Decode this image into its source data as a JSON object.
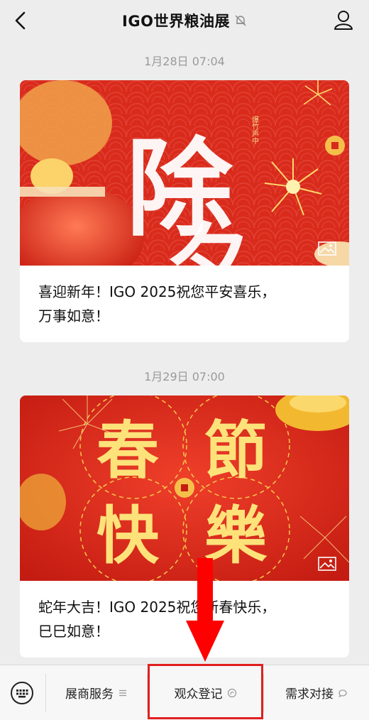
{
  "header": {
    "title": "IGO世界粮油展"
  },
  "messages": [
    {
      "date": "1月28日 07:04",
      "banner_text": "除夕",
      "caption_line1": "喜迎新年！IGO 2025祝您平安喜乐，",
      "caption_line2": "万事如意！"
    },
    {
      "date": "1月29日 07:00",
      "banner_text": "春節快樂",
      "caption_line1": "蛇年大吉！IGO 2025祝您新春快乐，",
      "caption_line2": "巳巳如意！"
    }
  ],
  "tabbar": {
    "items": [
      {
        "label": "展商服务",
        "icon": "menu-lines-icon"
      },
      {
        "label": "观众登记",
        "icon": "mini-program-icon"
      },
      {
        "label": "需求对接",
        "icon": "chat-bubble-icon"
      }
    ]
  },
  "colors": {
    "accent": "#e02020",
    "banner_red": "#d92b1c",
    "gold": "#f6c84a"
  }
}
